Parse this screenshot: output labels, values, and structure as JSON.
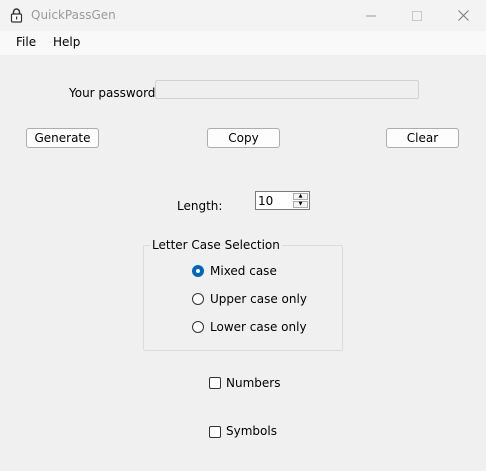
{
  "window": {
    "title": "QuickPassGen"
  },
  "menu": {
    "file": "File",
    "help": "Help"
  },
  "password": {
    "label": "Your password:",
    "value": ""
  },
  "buttons": {
    "generate": "Generate",
    "copy": "Copy",
    "clear": "Clear"
  },
  "length": {
    "label": "Length:",
    "value": "10"
  },
  "letter_case": {
    "group_label": "Letter Case Selection",
    "options": [
      {
        "label": "Mixed case",
        "selected": true
      },
      {
        "label": "Upper case only",
        "selected": false
      },
      {
        "label": "Lower case only",
        "selected": false
      }
    ]
  },
  "options": {
    "numbers": {
      "label": "Numbers",
      "checked": false
    },
    "symbols": {
      "label": "Symbols",
      "checked": false
    }
  },
  "colors": {
    "accent": "#0067c0",
    "background": "#f0f0f0"
  }
}
